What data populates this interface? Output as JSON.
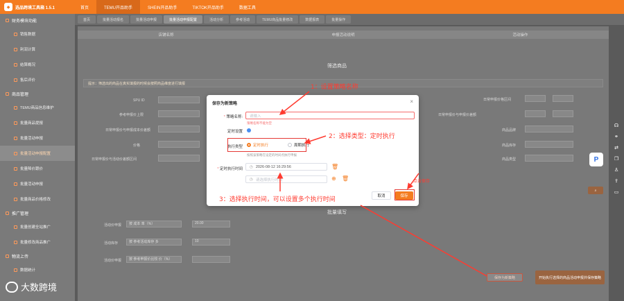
{
  "app": {
    "title": "选品跨境工具箱 1.5.1"
  },
  "topnav": [
    "首页",
    "TEMU开品助手",
    "SHEIN开品助手",
    "TIKTOK开品助手",
    "数据工具"
  ],
  "tabs": [
    "首页",
    "批量活动报名",
    "批量活动申报",
    "批量活动申报配置",
    "活动分析",
    "参考活动",
    "TEMU商品批量修改",
    "数据报表",
    "批量操作"
  ],
  "sidebar": {
    "groups": [
      {
        "label": "财务模块功能",
        "items": [
          "销售数据",
          "利润计算",
          "结算概况",
          "售后评价"
        ]
      },
      {
        "label": "商品管理",
        "items": [
          "TEMU商品信息维护",
          "批量商品提报",
          "批量活动申报",
          "批量活动申报配置",
          "批量降价跟价",
          "批量活动申报",
          "批量商品价格修改"
        ]
      },
      {
        "label": "推广管理",
        "items": [
          "批量创建全站推广",
          "批量修改商品推广"
        ]
      },
      {
        "label": "物流上传",
        "items": [
          "数据统计"
        ]
      }
    ]
  },
  "background": {
    "table_headers": [
      "店铺名称",
      "申报活动说明",
      "活动操作"
    ],
    "section_filter": "筛选商品",
    "hint": "提示：筛选出的商品在真实填报的时候会按照商品维度进行填报",
    "section_batch": "批量填写",
    "labels": [
      "价格",
      "参考申报价上限",
      "日常申报价与申报成本价差额",
      "SPU ID",
      "日常申报价与申报价差额",
      "日常申报价格区间",
      "日常申报价与活动价差额区间",
      "商品品牌",
      "商品库存",
      "商品类型"
    ],
    "bottom_rows": [
      {
        "label": "活动价申报",
        "value": "按 成本 率（%）",
        "num": "20.00"
      },
      {
        "label": "活动库存",
        "value": "按 参考活动库存 多",
        "num": "10"
      },
      {
        "label": "活动价申报",
        "value": "按 参考申报价比较 价（%）",
        "num": ""
      }
    ],
    "save_strategy_btn": "保存为新策略",
    "submit_btn": "开始执行选择的商品活动申报并保存策略"
  },
  "dialog": {
    "title": "保存为新策略",
    "name_label": "策略名称:",
    "name_placeholder": "请输入",
    "name_error": "策略名称不能为空",
    "timer_label": "定时设置",
    "type_label": "执行类型",
    "type_options": [
      "定时执行",
      "周期执行"
    ],
    "type_hint": "按照该策略在设定的时间点执行申报",
    "time_label": "定时执行时间",
    "time_value": "2026-08-12 16:29:56",
    "time_placeholder": "请选择执行时间",
    "cancel": "取消",
    "save": "保存"
  },
  "annotations": {
    "step1": "1：设置策略名称",
    "step2": "2：选择类型：定时执行",
    "step3": "3：选择执行时间，可以设置多个执行时间",
    "step4": "点击保存"
  },
  "watermark": "大数跨境",
  "colors": {
    "accent": "#f47c20",
    "annotation": "#ff3b30"
  }
}
